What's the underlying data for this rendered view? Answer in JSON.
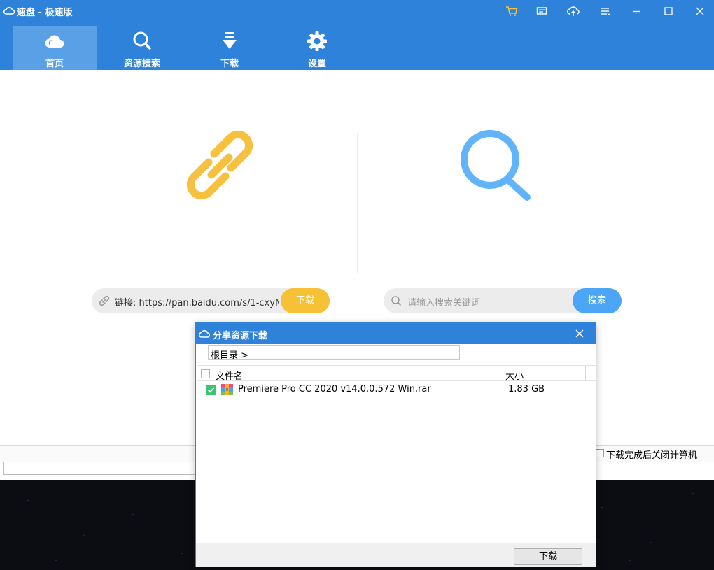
{
  "app": {
    "title": "速盘 - 极速版"
  },
  "colors": {
    "brand": "#2e82d9",
    "active_tab": "#5aa0e6",
    "download_button": "#f7c136",
    "search_button": "#4da6f5",
    "link_icon": "#f7c13f",
    "search_icon": "#62b4fa",
    "checkbox_checked": "#39c46e"
  },
  "window_controls": [
    "cart-icon",
    "message-icon",
    "upload-icon",
    "menu-icon",
    "minimize-icon",
    "maximize-icon",
    "close-icon"
  ],
  "nav": {
    "tabs": [
      {
        "label": "首页",
        "icon": "cloud-icon",
        "active": true
      },
      {
        "label": "资源搜索",
        "icon": "search-icon",
        "active": false
      },
      {
        "label": "下载",
        "icon": "download-arrow-icon",
        "active": false
      },
      {
        "label": "设置",
        "icon": "gear-icon",
        "active": false
      }
    ]
  },
  "link_panel": {
    "icon": "link-icon",
    "value": "链接: https://pan.baidu.com/s/1-cxyM...",
    "button": "下载"
  },
  "search_panel": {
    "icon": "search-icon",
    "placeholder": "请输入搜索关键词",
    "button": "搜索"
  },
  "footer": {
    "shutdown_label": "下载完成后关闭计算机",
    "shutdown_checked": false
  },
  "dialog": {
    "title": "分享资源下载",
    "path": "根目录 >",
    "columns": {
      "name": "文件名",
      "size": "大小"
    },
    "files": [
      {
        "name": "Premiere Pro CC 2020 v14.0.0.572 Win.rar",
        "size": "1.83 GB",
        "checked": true,
        "icon": "rar-archive-icon"
      }
    ],
    "download_button": "下载"
  }
}
